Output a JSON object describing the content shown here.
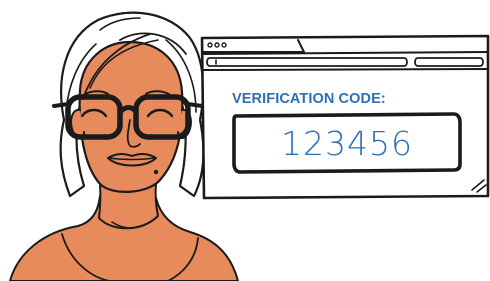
{
  "illustration": {
    "subject": "woman-with-glasses",
    "browser": {
      "label": "VERIFICATION CODE:",
      "code": "123456"
    }
  },
  "colors": {
    "skin": "#e88b5c",
    "outline": "#1b1b1b",
    "accent": "#2a6fb8",
    "background": "#ffffff"
  }
}
